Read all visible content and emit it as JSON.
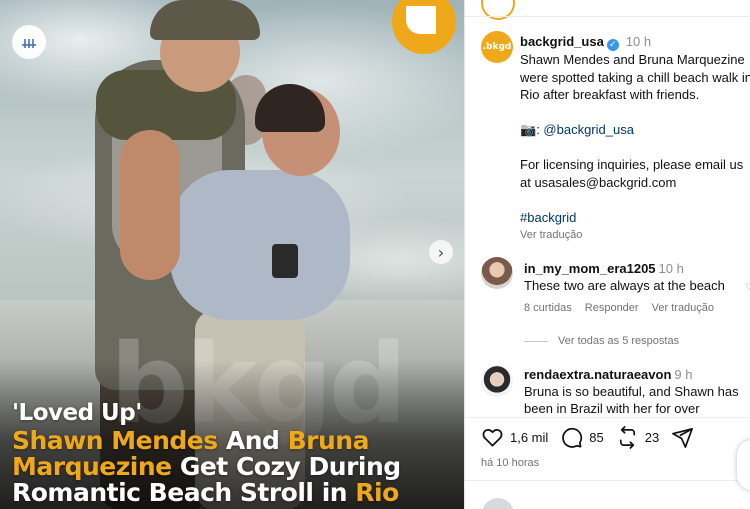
{
  "photo": {
    "watermark": "bkgd",
    "headline": {
      "kicker": "'Loved Up'",
      "line1_a": "Shawn Mendes",
      "line1_b": "And",
      "line1_c": "Bruna",
      "line2_a": "Marquezine",
      "line2_b": "Get Cozy During",
      "line3_a": "Romantic Beach Stroll in",
      "line3_b": "Rio"
    },
    "corner_icon": "sliders-icon",
    "next_icon": "chevron-right-icon"
  },
  "post": {
    "author": {
      "username": "backgrid_usa",
      "avatar_text": ".bkgd",
      "verified": true,
      "time": "10 h"
    },
    "caption": {
      "line1": "Shawn Mendes and Bruna Marquezine were spotted taking a chill beach walk in Rio after breakfast with friends.",
      "camera_emoji": "📷",
      "camera_sep": ": ",
      "mention": "@backgrid_usa",
      "licensing": "For licensing inquiries, please email us at usasales@backgrid.com",
      "hashtag": "#backgrid",
      "see_translation": "Ver tradução"
    }
  },
  "comments": [
    {
      "username": "in_my_mom_era1205",
      "time": "10 h",
      "text": "These two are always at the beach",
      "likes": "8 curtidas",
      "reply": "Responder",
      "translate": "Ver tradução",
      "view_replies": "Ver todas as 5 respostas"
    },
    {
      "username": "rendaextra.naturaeavon",
      "time": "9 h",
      "text": "Bruna is so beautiful, and Shawn has been in Brazil with her for over"
    }
  ],
  "actions": {
    "likes": "1,6 mil",
    "comments": "85",
    "reposts": "23",
    "posted_ago": "há 10 horas"
  },
  "colors": {
    "brand": "#f0a81b",
    "verified": "#3897f0",
    "link": "#00376b",
    "muted": "#737373"
  }
}
